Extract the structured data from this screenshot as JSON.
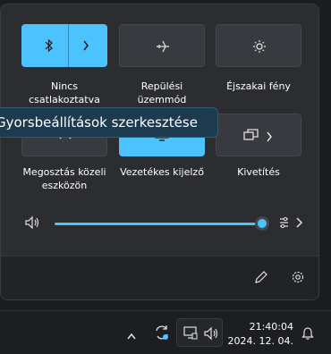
{
  "tiles": [
    {
      "label_line1": "Nincs",
      "label_line2": "csatlakoztatva",
      "icon": "bluetooth-icon",
      "state": "on"
    },
    {
      "label_line1": "Repülési",
      "label_line2": "üzemmód",
      "icon": "airplane-icon",
      "state": "off"
    },
    {
      "label_line1": "Éjszakai fény",
      "label_line2": "",
      "icon": "night-light-icon",
      "state": "off"
    },
    {
      "label_line1": "Megosztás közeli",
      "label_line2": "eszközön",
      "icon": "nearby-share-icon",
      "state": "off"
    },
    {
      "label_line1": "Vezetékes kijelző",
      "label_line2": "",
      "icon": "wired-display-icon",
      "state": "on"
    },
    {
      "label_line1": "Kivetítés",
      "label_line2": "",
      "icon": "project-icon",
      "state": "off"
    }
  ],
  "tooltip": {
    "text": "Gyorsbeállítások szerkesztése"
  },
  "volume": {
    "level_percent": 100
  },
  "taskbar": {
    "time": "21:40:04",
    "date": "2024. 12. 04."
  },
  "colors": {
    "accent": "#4cc2ff",
    "panel": "#2b2d31",
    "footer": "#212327",
    "tooltip": "#1d3b4e"
  }
}
